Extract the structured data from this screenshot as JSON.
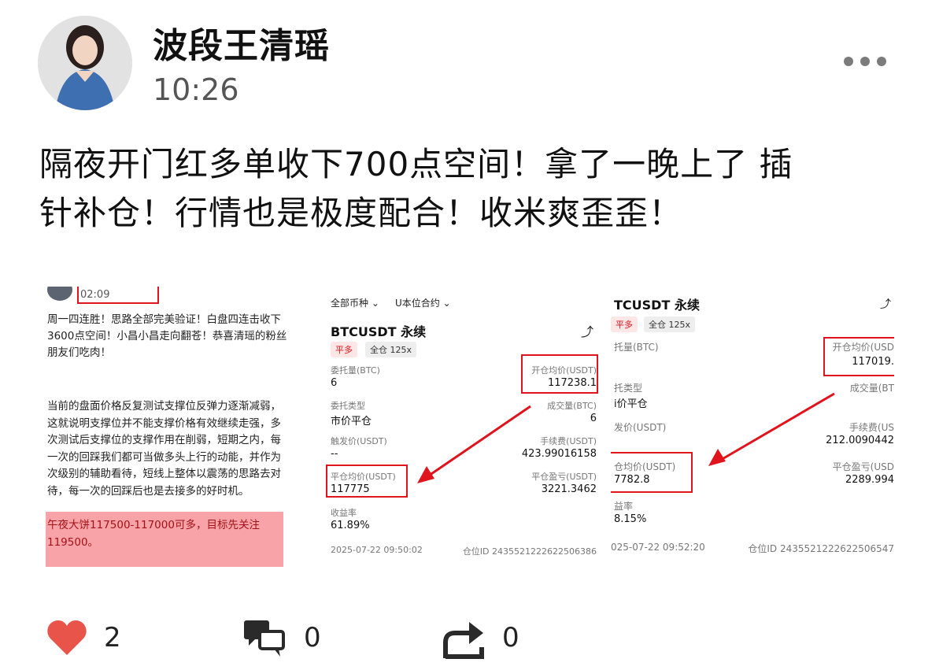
{
  "post": {
    "author": "波段王清瑶",
    "time": "10:26",
    "text_lines": [
      "隔夜开门红多单收下700点空间！拿了一晚上了  插",
      "针补仓！行情也是极度配合！收米爽歪歪！"
    ]
  },
  "image1": {
    "time": "02:09",
    "para1": [
      "周一四连胜！思路全部完美验证！白盘四连击收下",
      "3600点空间！小昌小昌走向翻苍！恭喜清瑶的粉丝",
      "朋友们吃肉！"
    ],
    "para2": [
      "当前的盘面价格反复测试支撑位反弹力逐渐减弱，",
      "这就说明支撑位并不能支撑价格有效继续走强，多",
      "次测试后支撑位的支撑作用在削弱，短期之内，每",
      "一次的回踩我们都可当做多头上行的动能，并作为",
      "次级别的辅助看待，短线上整体以震荡的思路去对",
      "待，每一次的回踩后也是去接多的好时机。"
    ],
    "highlight": [
      "午夜大饼117500-117000可多，目标先关注",
      "119500。"
    ],
    "colors": {
      "highlight_bg": "#f7a3a8",
      "highlight_text": "#a31218"
    }
  },
  "image2": {
    "filter_all": "全部币种",
    "filter_contract": "U本位合约",
    "symbol": "BTCUSDT 永续",
    "side_tag": "平多",
    "margin_tag": "全仓 125x",
    "fields": {
      "order_qty_label": "委托量(BTC)",
      "order_qty": "6",
      "open_avg_label": "开仓均价(USDT)",
      "open_avg": "117238.1",
      "order_type_label": "委托类型",
      "order_type": "市价平仓",
      "filled_label": "成交量(BTC)",
      "filled": "6",
      "trigger_label": "触发价(USDT)",
      "trigger": "--",
      "fee_label": "手续费(USDT)",
      "fee": "423.99016158",
      "close_avg_label": "平仓均价(USDT)",
      "close_avg": "117775",
      "pnl_label": "平仓盈亏(USDT)",
      "pnl": "3221.3462",
      "roi_label": "收益率",
      "roi": "61.89%",
      "timestamp": "2025-07-22 09:50:02",
      "position_id": "仓位ID 2435521222622506386"
    }
  },
  "image3": {
    "symbol": "TCUSDT 永续",
    "side_tag": "平多",
    "margin_tag": "全仓 125x",
    "fields": {
      "order_qty_label": "托量(BTC)",
      "open_avg_label": "开仓均价(USD",
      "open_avg": "117019.",
      "order_type_label": "托类型",
      "order_type": "i价平仓",
      "filled_label": "成交量(BT",
      "trigger_label": "发价(USDT)",
      "fee_label": "手续费(US",
      "fee": "212.0090442",
      "close_avg_label": "仓均价(USDT)",
      "close_avg": "7782.8",
      "pnl_label": "平仓盈亏(USD",
      "pnl": "2289.994",
      "roi_label": "益率",
      "roi": "8.15%",
      "timestamp": "025-07-22 09:52:20",
      "position_id": "仓位ID 2435521222622506547"
    }
  },
  "actions": {
    "likes": "2",
    "comments": "0",
    "shares": "0"
  },
  "colors": {
    "accent_red": "#e0141c",
    "heart": "#e8534a",
    "tag_bg": "#fde6e6",
    "tag_text": "#e0141c"
  },
  "icons": {
    "more": "more-dots-icon",
    "like": "heart-icon",
    "comment": "comment-icon",
    "share": "share-icon"
  }
}
